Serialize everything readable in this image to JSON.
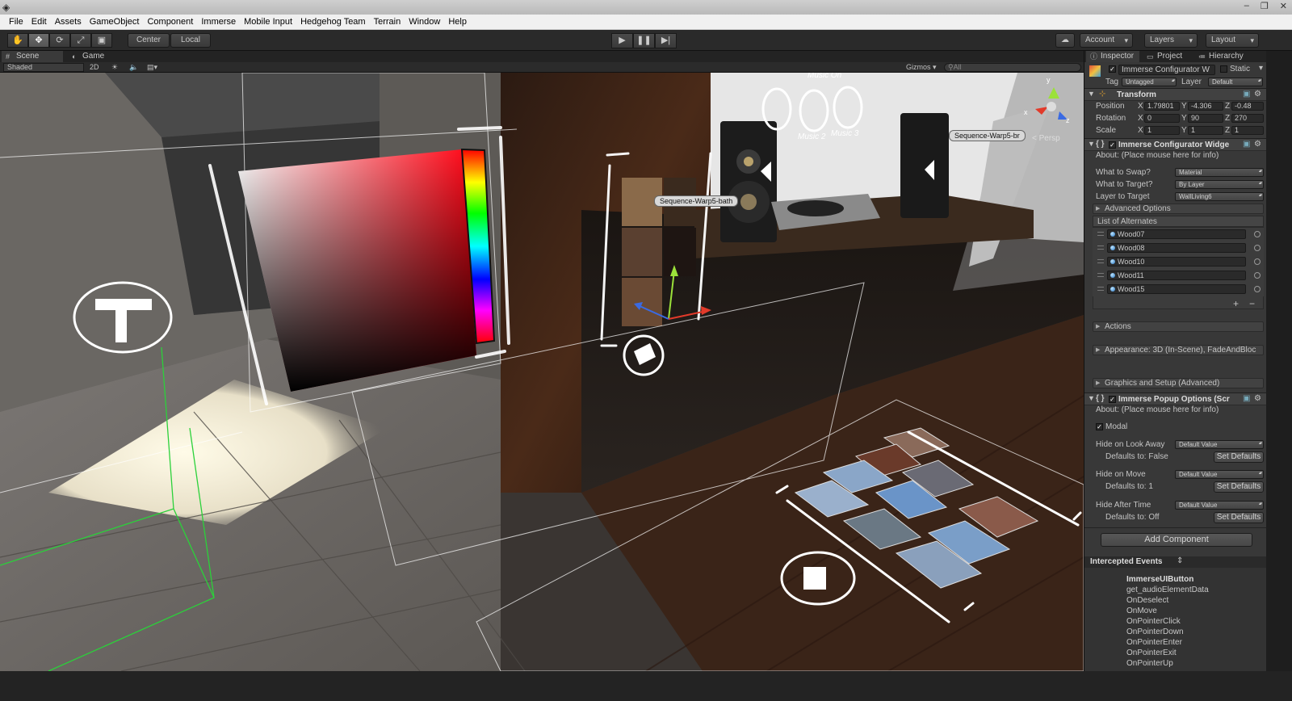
{
  "window": {
    "minimize": "‒",
    "maximize": "❐",
    "close": "✕"
  },
  "menu": [
    "File",
    "Edit",
    "Assets",
    "GameObject",
    "Component",
    "Immerse",
    "Mobile Input",
    "Hedgehog Team",
    "Terrain",
    "Window",
    "Help"
  ],
  "toolbar": {
    "tools": [
      "hand-icon",
      "move-icon",
      "rotate-icon",
      "scale-icon",
      "rect-icon"
    ],
    "pivot": "Center",
    "space": "Local",
    "play": "▶",
    "pause": "❚❚",
    "step": "▶|",
    "account": "Account",
    "layers": "Layers",
    "layout": "Layout"
  },
  "scene": {
    "tabs": [
      "Scene",
      "Game"
    ],
    "shading": "Shaded",
    "mode2d": "2D",
    "gizmos": "Gizmos",
    "search_placeholder": "All",
    "labels": {
      "seq_bath": "Sequence-Warp5-bath",
      "seq_br": "Sequence-Warp5-br",
      "persp": "< Persp",
      "music_on": "Music On",
      "music2": "Music 2",
      "music3": "Music 3"
    }
  },
  "inspector": {
    "tabs": [
      "Inspector",
      "Project",
      "Hierarchy"
    ],
    "object_name": "Immerse Configurator W",
    "static": "Static",
    "tag_label": "Tag",
    "tag": "Untagged",
    "layer_label": "Layer",
    "layer": "Default",
    "transform": {
      "title": "Transform",
      "position_label": "Position",
      "position": [
        "1.79801",
        "-4.306",
        "-0.48"
      ],
      "rotation_label": "Rotation",
      "rotation": [
        "0",
        "90",
        "270"
      ],
      "scale_label": "Scale",
      "scale": [
        "1",
        "1",
        "1"
      ]
    },
    "configurator": {
      "title": "Immerse Configurator Widge",
      "about": "About: (Place mouse here for info)",
      "what_to_swap_label": "What to Swap?",
      "what_to_swap": "Material",
      "what_to_target_label": "What to Target?",
      "what_to_target": "By Layer",
      "layer_to_target_label": "Layer to Target",
      "layer_to_target": "WallLiving6",
      "advanced_options": "Advanced Options",
      "list_label": "List of Alternates",
      "alternates": [
        "Wood07",
        "Wood08",
        "Wood10",
        "Wood11",
        "Wood15"
      ],
      "actions": "Actions",
      "appearance": "Appearance: 3D (In-Scene), FadeAndBloc",
      "graphics": "Graphics and Setup (Advanced)"
    },
    "popup": {
      "title": "Immerse Popup Options (Scr",
      "about": "About: (Place mouse here for info)",
      "modal": "Modal",
      "look_away_label": "Hide on Look Away",
      "look_away": "Default Value",
      "look_away_default": "Defaults to: False",
      "on_move_label": "Hide on Move",
      "on_move": "Default Value",
      "on_move_default": "Defaults to: 1",
      "after_time_label": "Hide After Time",
      "after_time": "Default Value",
      "after_time_default": "Defaults to: Off",
      "set_defaults": "Set Defaults"
    },
    "add_component": "Add Component",
    "intercepted_events": "Intercepted Events",
    "events": [
      "ImmerseUIButton",
      "get_audioElementData",
      "OnDeselect",
      "OnMove",
      "OnPointerClick",
      "OnPointerDown",
      "OnPointerEnter",
      "OnPointerExit",
      "OnPointerUp"
    ]
  }
}
